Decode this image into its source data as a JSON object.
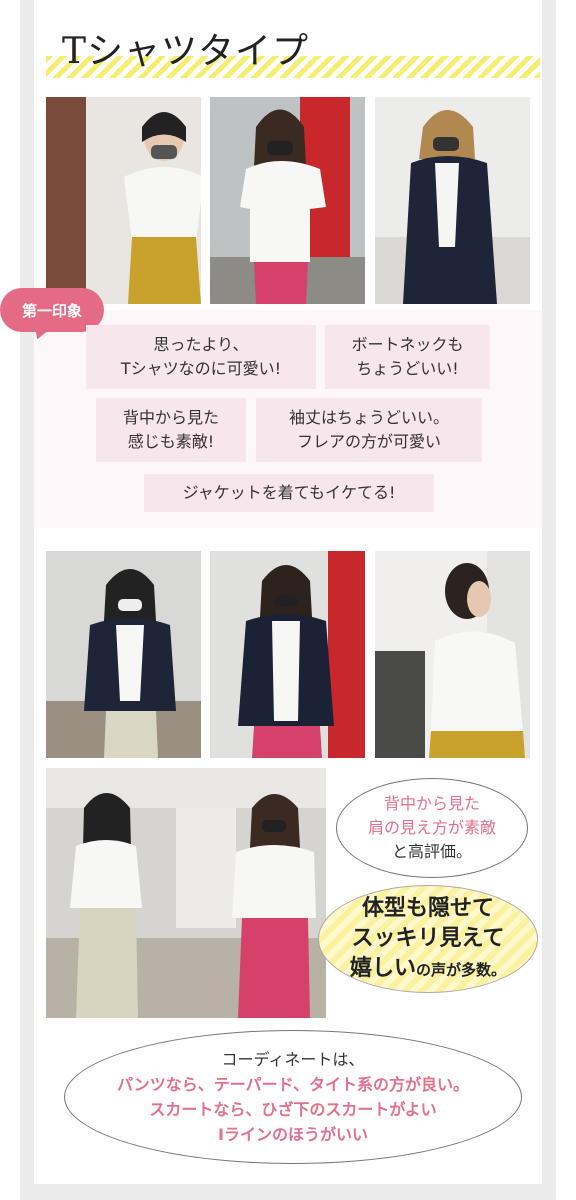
{
  "title": "Tシャツタイプ",
  "badge": "第一印象",
  "impressions": [
    "思ったより、\nTシャツなのに可愛い!",
    "ボートネックも\nちょうどいい!",
    "背中から見た\n感じも素敵!",
    "袖丈はちょうどいい。\nフレアの方が可愛い",
    "ジャケットを着てもイケてる!"
  ],
  "bubble_back": {
    "line1": "背中から見た",
    "line2": "肩の見え方が素敵",
    "line3": "と高評価。"
  },
  "bubble_body": {
    "line1": "体型も隠せて",
    "line2": "スッキリ見えて",
    "line3_big": "嬉しい",
    "line3_small": "の声が多数。"
  },
  "bubble_coord": {
    "line1": "コーディネートは、",
    "line2": "パンツなら、テーパード、タイト系の方が良い。",
    "line3": "スカートなら、ひざ下のスカートがよい",
    "line4": "Iラインのほうがいい"
  },
  "colors": {
    "accent_pink": "#e46a85",
    "stripe_yellow": "#f6ee6e",
    "tag_bg": "#f7e6ec"
  }
}
